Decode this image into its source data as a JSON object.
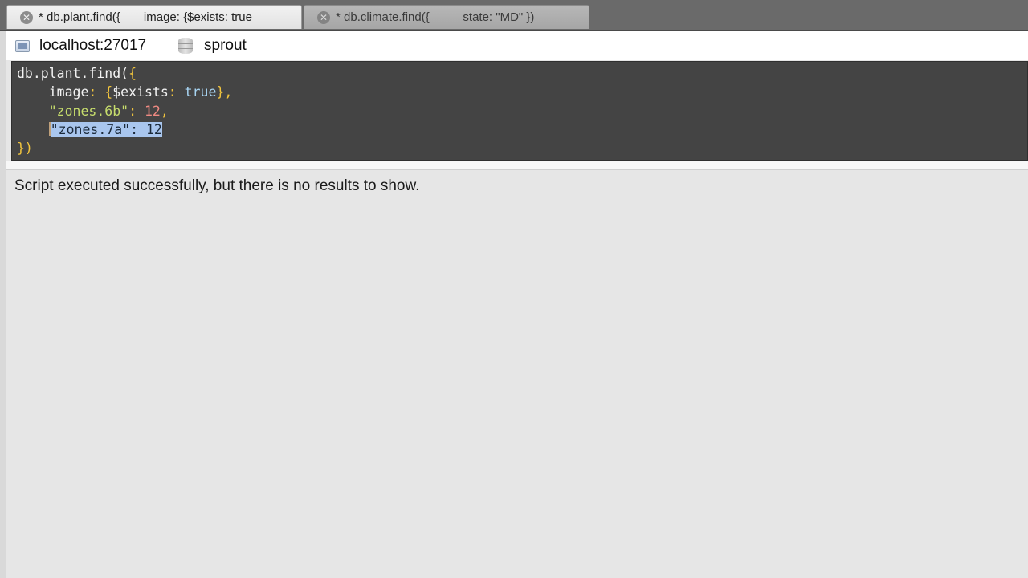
{
  "tabs": [
    {
      "title": "* db.plant.find({       image: {$exists: true",
      "active": true
    },
    {
      "title": "* db.climate.find({          state: \"MD\" })",
      "active": false
    }
  ],
  "connection": {
    "server": "localhost:27017",
    "database": "sprout",
    "server_icon": "monitor-icon",
    "database_icon": "database-icon"
  },
  "editor": {
    "line1": {
      "a": "db.plant.find(",
      "b": "{"
    },
    "line2": {
      "indent": "    ",
      "key": "image",
      "colon": ": ",
      "open": "{",
      "op": "$exists",
      "colon2": ": ",
      "val": "true",
      "close": "}",
      "comma": ","
    },
    "line3": {
      "indent": "    ",
      "key": "\"zones.6b\"",
      "colon": ": ",
      "val": "12",
      "comma": ","
    },
    "line4": {
      "indent": "    ",
      "selected": "\"zones.7a\": 12"
    },
    "line5": {
      "close": "})"
    }
  },
  "result": {
    "message": "Script executed successfully, but there is no results to show."
  },
  "colors": {
    "editor_bg": "#444444",
    "keyword_yellow": "#f2c53d",
    "string_green": "#c6dc6c",
    "number_red": "#ef8a82",
    "bool_blue": "#a7d4f2",
    "selection": "#a9c6ee"
  }
}
